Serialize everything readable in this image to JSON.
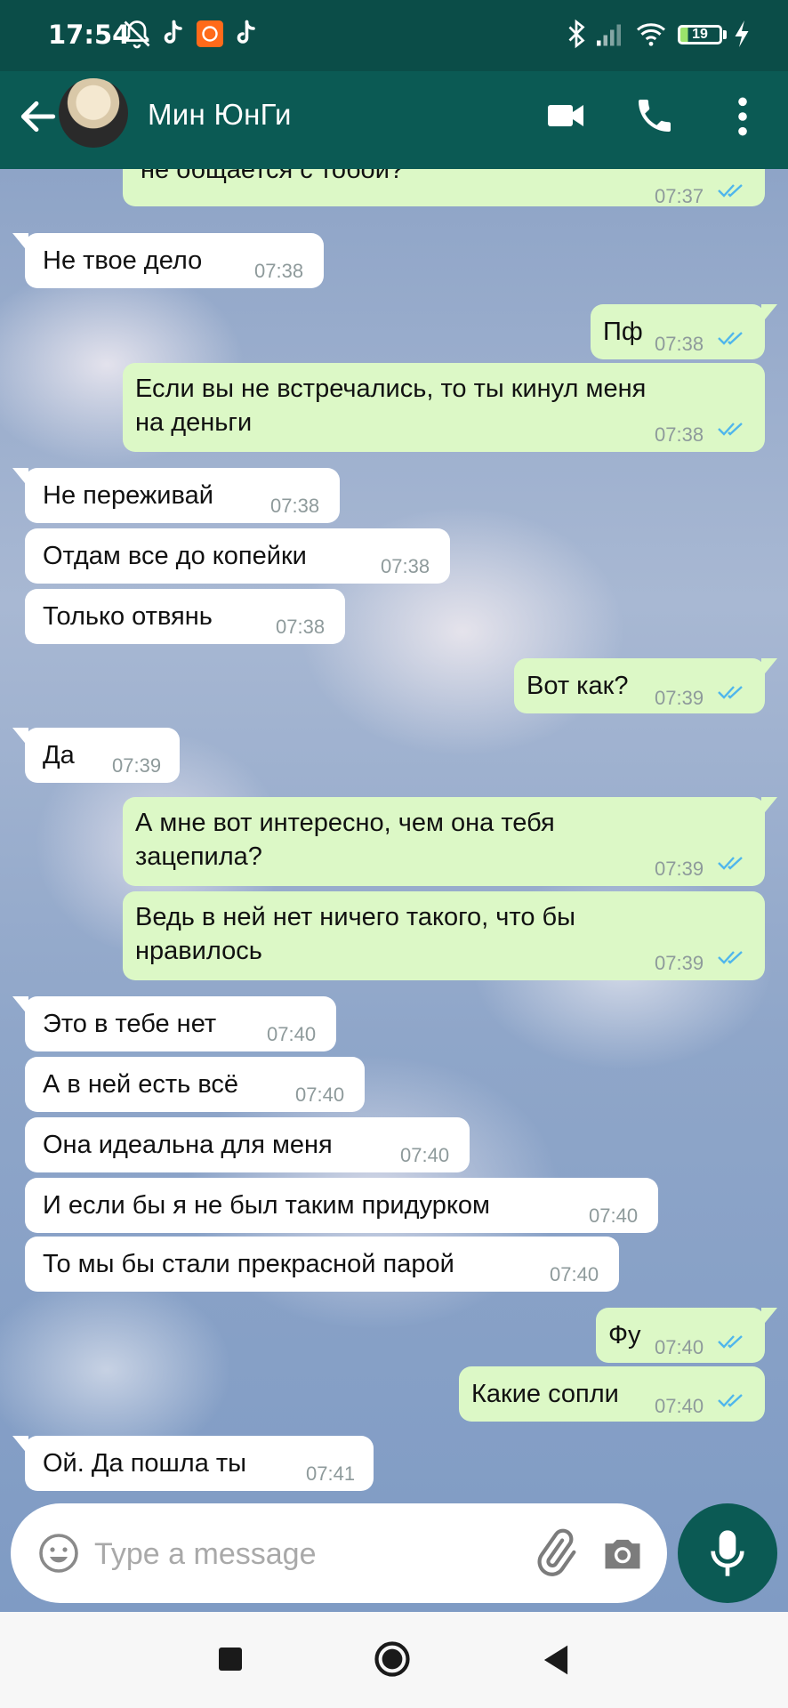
{
  "status_bar": {
    "time": "17:54",
    "battery_level": "19"
  },
  "header": {
    "contact_name": "Мин ЮнГи"
  },
  "messages": [
    {
      "dir": "out",
      "text": "не общается с тобой?",
      "time": "07:37",
      "read": true
    },
    {
      "dir": "in",
      "text": "Не твое дело",
      "time": "07:38"
    },
    {
      "dir": "out",
      "text": "Пф",
      "time": "07:38",
      "read": true
    },
    {
      "dir": "out",
      "text_line1": "Если вы не встречались, то ты кинул меня",
      "text_line2": "на деньги",
      "time": "07:38",
      "read": true
    },
    {
      "dir": "in",
      "text": "Не переживай",
      "time": "07:38"
    },
    {
      "dir": "in",
      "text": "Отдам все до копейки",
      "time": "07:38"
    },
    {
      "dir": "in",
      "text": "Только отвянь",
      "time": "07:38"
    },
    {
      "dir": "out",
      "text": "Вот как?",
      "time": "07:39",
      "read": true
    },
    {
      "dir": "in",
      "text": "Да",
      "time": "07:39"
    },
    {
      "dir": "out",
      "text_line1": "А мне вот интересно, чем она тебя",
      "text_line2": "зацепила?",
      "time": "07:39",
      "read": true
    },
    {
      "dir": "out",
      "text_line1": "Ведь в ней нет ничего такого, что бы",
      "text_line2": "нравилось",
      "time": "07:39",
      "read": true
    },
    {
      "dir": "in",
      "text": "Это в тебе нет",
      "time": "07:40"
    },
    {
      "dir": "in",
      "text": "А в ней есть всё",
      "time": "07:40"
    },
    {
      "dir": "in",
      "text": "Она идеальна для меня",
      "time": "07:40"
    },
    {
      "dir": "in",
      "text": "И если бы я не был таким придурком",
      "time": "07:40"
    },
    {
      "dir": "in",
      "text": "То мы бы стали прекрасной парой",
      "time": "07:40"
    },
    {
      "dir": "out",
      "text": "Фу",
      "time": "07:40",
      "read": true
    },
    {
      "dir": "out",
      "text": "Какие сопли",
      "time": "07:40",
      "read": true
    },
    {
      "dir": "in",
      "text": "Ой. Да пошла ты",
      "time": "07:41"
    }
  ],
  "input": {
    "placeholder": "Type a message"
  },
  "icons": {
    "status": [
      "bell-off-icon",
      "tiktok-icon",
      "mi-app-icon",
      "tiktok-icon",
      "bluetooth-icon",
      "signal-icon",
      "wifi-icon",
      "charging-icon"
    ],
    "header": [
      "back-arrow-icon",
      "video-call-icon",
      "phone-icon",
      "more-vert-icon"
    ],
    "input": [
      "emoji-icon",
      "attach-icon",
      "camera-icon",
      "mic-icon"
    ],
    "nav": [
      "recents-icon",
      "home-icon",
      "back-icon"
    ]
  },
  "colors": {
    "header": "#0b5a54",
    "status_bar": "#0b4d48",
    "outgoing_bubble": "#dcf8c6",
    "incoming_bubble": "#ffffff",
    "read_ticks": "#4fb6ec"
  }
}
